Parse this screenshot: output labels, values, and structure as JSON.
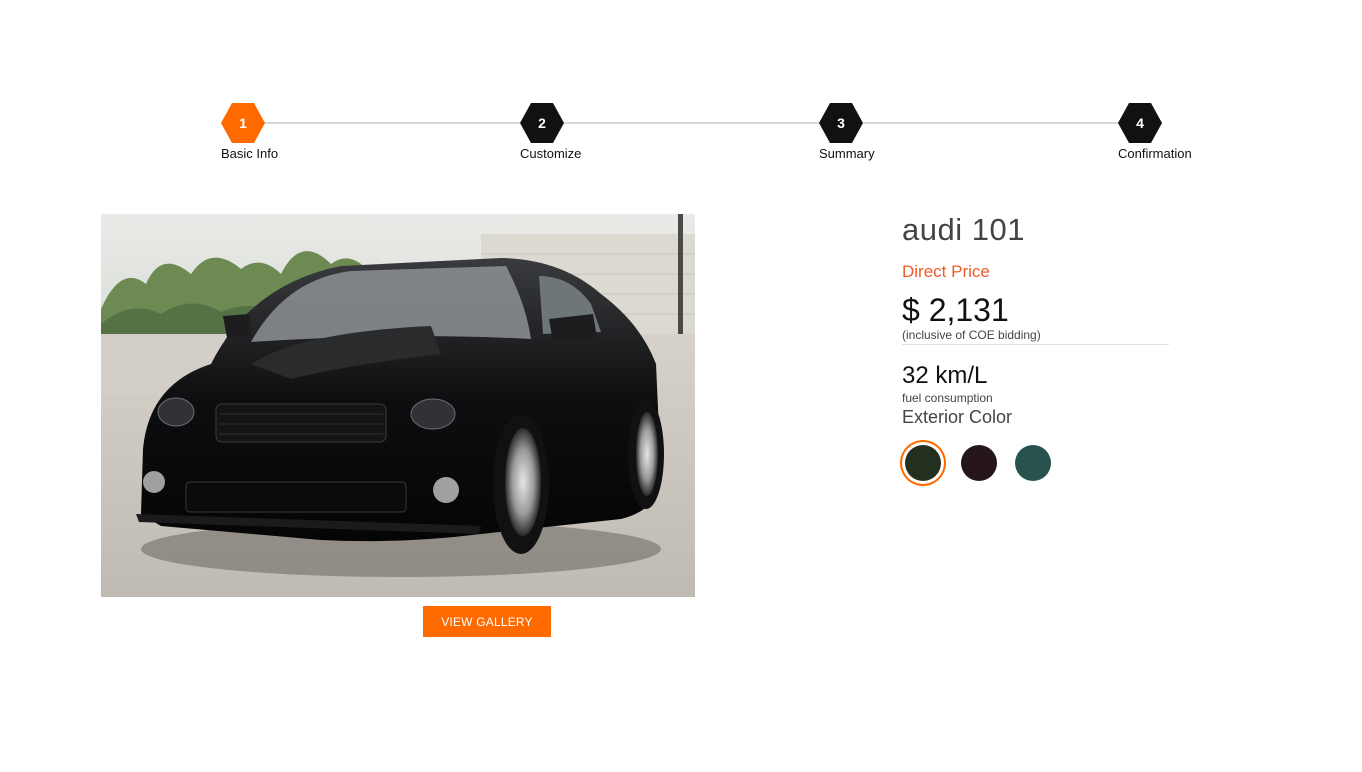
{
  "stepper": {
    "steps": [
      {
        "number": "1",
        "label": "Basic Info",
        "active": true
      },
      {
        "number": "2",
        "label": "Customize",
        "active": false
      },
      {
        "number": "3",
        "label": "Summary",
        "active": false
      },
      {
        "number": "4",
        "label": "Confirmation",
        "active": false
      }
    ]
  },
  "car": {
    "model": "audi 101",
    "gallery_button": "VIEW GALLERY"
  },
  "pricing": {
    "label": "Direct Price",
    "price": "$ 2,131",
    "note": "(inclusive of COE bidding)"
  },
  "fuel": {
    "value": "32 km/L",
    "label": "fuel consumption"
  },
  "exterior": {
    "title": "Exterior Color",
    "colors": [
      "#23301f",
      "#26161b",
      "#27524d"
    ],
    "selected_index": 0
  },
  "theme": {
    "accent": "#ff6a00"
  }
}
